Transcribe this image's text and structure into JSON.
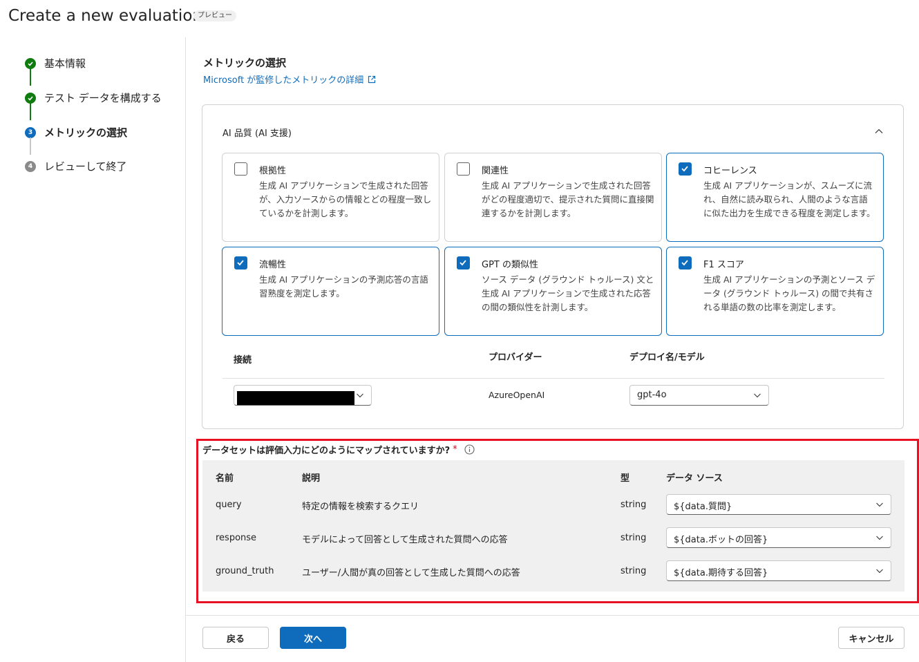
{
  "header": {
    "title": "Create a new evaluation",
    "badge": "プレビュー"
  },
  "steps": [
    {
      "label": "基本情報",
      "state": "done"
    },
    {
      "label": "テスト データを構成する",
      "state": "done"
    },
    {
      "label": "メトリックの選択",
      "state": "current",
      "number": "3"
    },
    {
      "label": "レビューして終了",
      "state": "todo",
      "number": "4"
    }
  ],
  "main": {
    "title": "メトリックの選択",
    "link": "Microsoft が監修したメトリックの詳細",
    "group_title": "AI 品質 (AI 支援)",
    "metrics": [
      {
        "title": "根拠性",
        "desc": "生成 AI アプリケーションで生成された回答が、入力ソースからの情報とどの程度一致しているかを計測します。",
        "checked": false
      },
      {
        "title": "関連性",
        "desc": "生成 AI アプリケーションで生成された回答がどの程度適切で、提示された質問に直接関連するかを計測します。",
        "checked": false
      },
      {
        "title": "コヒーレンス",
        "desc": "生成 AI アプリケーションが、スムーズに流れ、自然に読み取られ、人間のような言語に似た出力を生成できる程度を測定します。",
        "checked": true
      },
      {
        "title": "流暢性",
        "desc": "生成 AI アプリケーションの予測応答の言語習熟度を測定します。",
        "checked": true
      },
      {
        "title": "GPT の類似性",
        "desc": "ソース データ (グラウンド トゥルース) 文と生成 AI アプリケーションで生成された応答の間の類似性を計測します。",
        "checked": true
      },
      {
        "title": "F1 スコア",
        "desc": "生成 AI アプリケーションの予測とソース データ (グラウンド トゥルース) の間で共有される単語の数の比率を測定します。",
        "checked": true
      }
    ],
    "connection": {
      "col_connection": "接続",
      "col_provider": "プロバイダー",
      "col_deployment": "デプロイ名/モデル",
      "provider": "AzureOpenAI",
      "deployment": "gpt-4o"
    },
    "mapping": {
      "question": "データセットは評価入力にどのようにマップされていますか?",
      "required_mark": "*",
      "headers": {
        "name": "名前",
        "desc": "説明",
        "type": "型",
        "source": "データ ソース"
      },
      "rows": [
        {
          "name": "query",
          "desc": "特定の情報を検索するクエリ",
          "type": "string",
          "source": "${data.質問}"
        },
        {
          "name": "response",
          "desc": "モデルによって回答として生成された質問への応答",
          "type": "string",
          "source": "${data.ボットの回答}"
        },
        {
          "name": "ground_truth",
          "desc": "ユーザー/人間が真の回答として生成した質問への応答",
          "type": "string",
          "source": "${data.期待する回答}"
        }
      ]
    }
  },
  "footer": {
    "back": "戻る",
    "next": "次へ",
    "cancel": "キャンセル"
  },
  "colors": {
    "accent": "#0f6cbd",
    "success": "#107c10",
    "highlight": "#e81123"
  }
}
